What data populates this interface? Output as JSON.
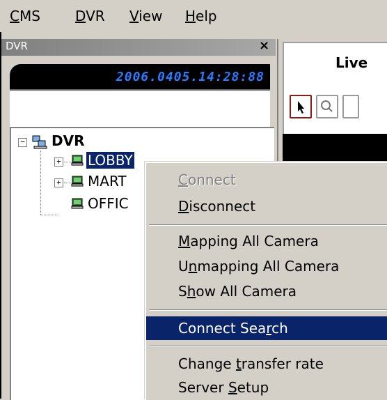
{
  "menubar": {
    "items": [
      {
        "label": "CMS",
        "mnemonic": "C",
        "rest": "MS"
      },
      {
        "label": "DVR",
        "mnemonic": "D",
        "rest": "VR"
      },
      {
        "label": "View",
        "mnemonic": "V",
        "rest": "iew"
      },
      {
        "label": "Help",
        "mnemonic": "H",
        "rest": "elp"
      }
    ]
  },
  "panel": {
    "title": "DVR",
    "close": "×",
    "clock": "2006.0405.14:28:88"
  },
  "tree": {
    "root": "DVR",
    "children": [
      {
        "label": "LOBBY"
      },
      {
        "label": "MART"
      },
      {
        "label": "OFFIC"
      }
    ]
  },
  "right_pane": {
    "tab_label": "Live"
  },
  "context_menu": {
    "items": [
      {
        "pre": "",
        "mn": "C",
        "post": "onnect",
        "disabled": true
      },
      {
        "pre": "",
        "mn": "D",
        "post": "isconnect"
      },
      {
        "pre": "",
        "mn": "M",
        "post": "apping All Camera"
      },
      {
        "pre": "U",
        "mn": "n",
        "post": "mapping All Camera"
      },
      {
        "pre": "S",
        "mn": "h",
        "post": "ow All Camera"
      },
      {
        "pre": "Connect Sea",
        "mn": "r",
        "post": "ch",
        "selected": true
      },
      {
        "pre": "Change ",
        "mn": "t",
        "post": "ransfer rate"
      },
      {
        "pre": "Server ",
        "mn": "S",
        "post": "etup"
      }
    ]
  },
  "colors": {
    "selection": "#0a246a",
    "clock_text": "#2a7bff",
    "face": "#d4d0c8"
  }
}
